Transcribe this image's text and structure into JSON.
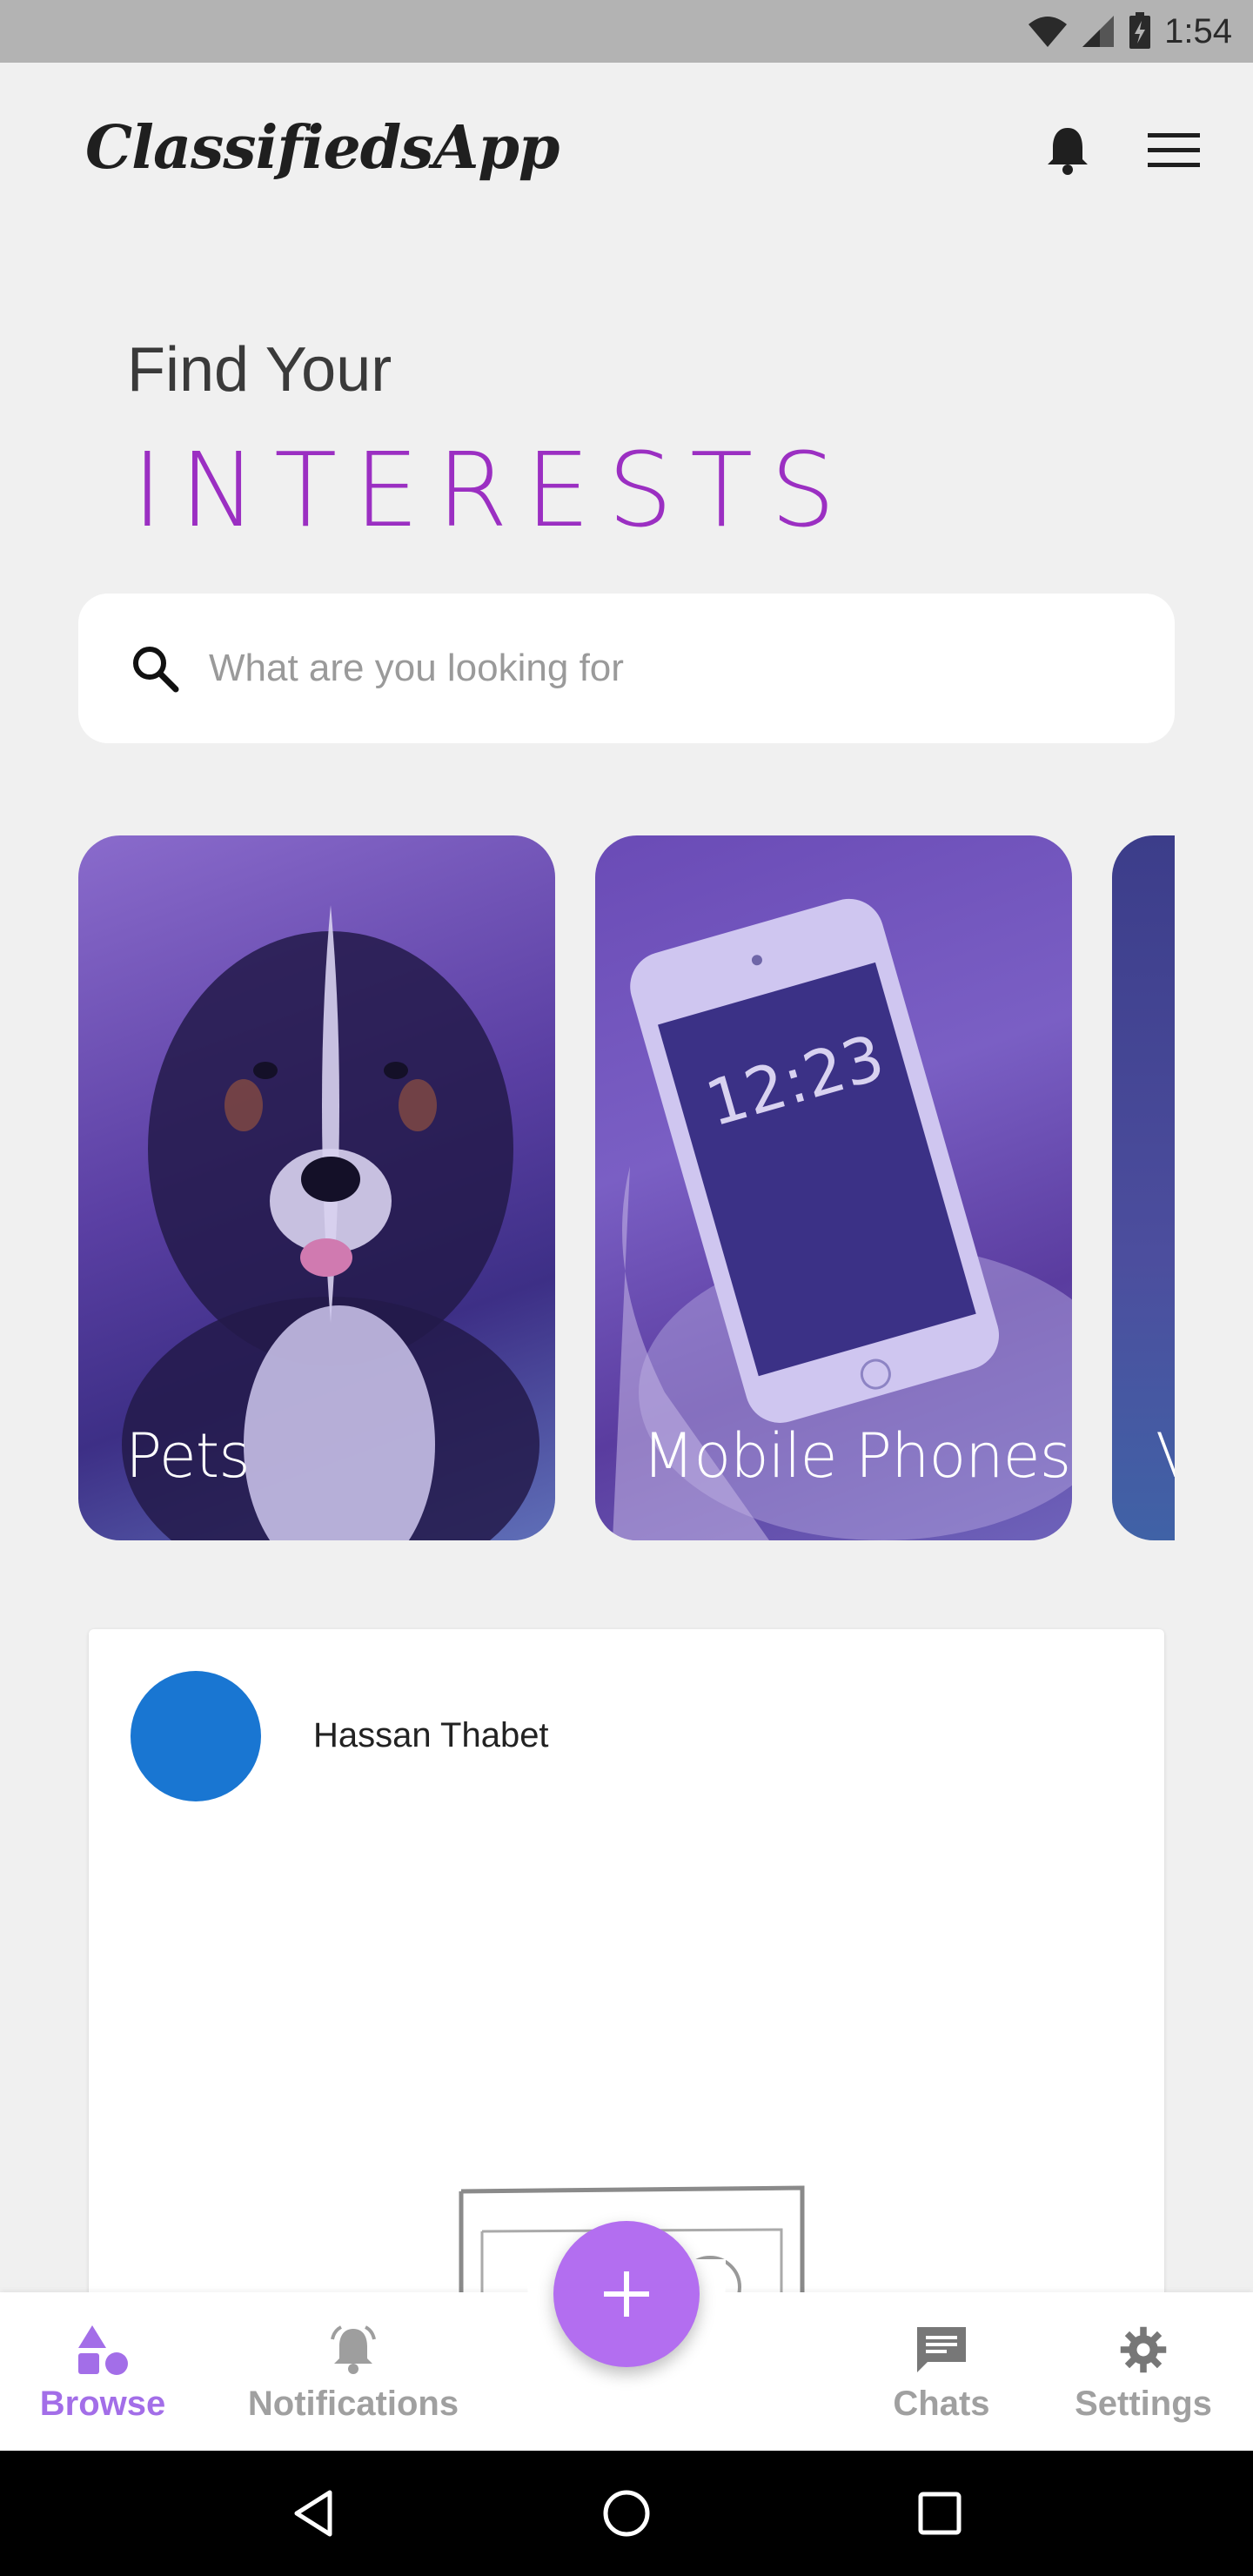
{
  "status_bar": {
    "time": "1:54"
  },
  "header": {
    "logo": "ClassifiedsApp"
  },
  "hero": {
    "line1": "Find Your",
    "line2": "INTERESTS"
  },
  "search": {
    "placeholder": "What are you looking for"
  },
  "categories": [
    {
      "label": "Pets"
    },
    {
      "label": "Mobile Phones"
    },
    {
      "label": "V"
    }
  ],
  "listing": {
    "seller_name": "Hassan Thabet",
    "avatar_color": "#1976d2"
  },
  "bottom_nav": {
    "items": [
      {
        "label": "Browse",
        "icon": "browse-icon",
        "active": true
      },
      {
        "label": "Notifications",
        "icon": "bell-icon",
        "active": false
      },
      {
        "label": "Chats",
        "icon": "chat-icon",
        "active": false
      },
      {
        "label": "Settings",
        "icon": "gear-icon",
        "active": false
      }
    ]
  },
  "colors": {
    "accent": "#a36ee8",
    "hero_purple": "#9b2fc2",
    "fab": "#b36ef0"
  }
}
